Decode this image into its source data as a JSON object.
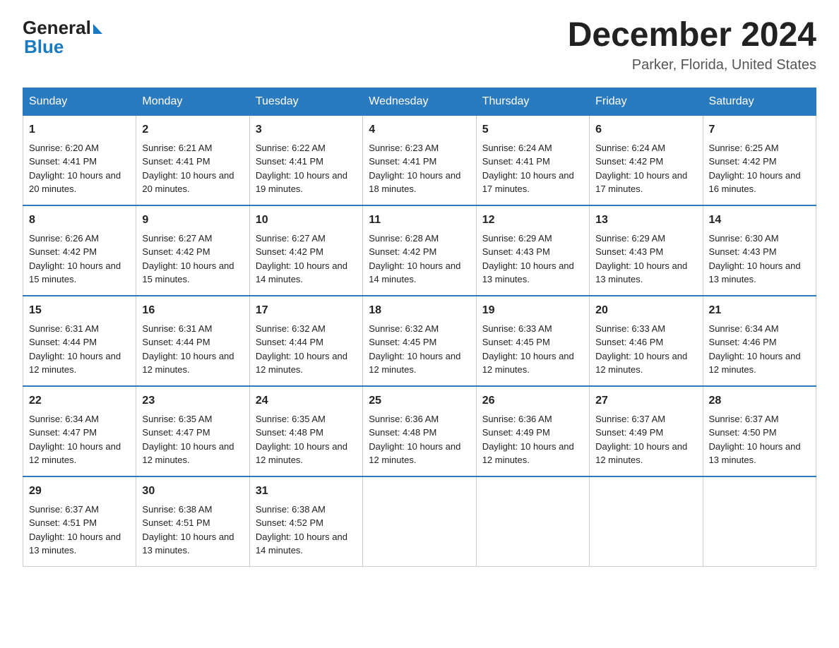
{
  "logo": {
    "line1": "General",
    "line2": "Blue"
  },
  "title": "December 2024",
  "subtitle": "Parker, Florida, United States",
  "days_header": [
    "Sunday",
    "Monday",
    "Tuesday",
    "Wednesday",
    "Thursday",
    "Friday",
    "Saturday"
  ],
  "weeks": [
    [
      {
        "num": "1",
        "sunrise": "6:20 AM",
        "sunset": "4:41 PM",
        "daylight": "10 hours and 20 minutes."
      },
      {
        "num": "2",
        "sunrise": "6:21 AM",
        "sunset": "4:41 PM",
        "daylight": "10 hours and 20 minutes."
      },
      {
        "num": "3",
        "sunrise": "6:22 AM",
        "sunset": "4:41 PM",
        "daylight": "10 hours and 19 minutes."
      },
      {
        "num": "4",
        "sunrise": "6:23 AM",
        "sunset": "4:41 PM",
        "daylight": "10 hours and 18 minutes."
      },
      {
        "num": "5",
        "sunrise": "6:24 AM",
        "sunset": "4:41 PM",
        "daylight": "10 hours and 17 minutes."
      },
      {
        "num": "6",
        "sunrise": "6:24 AM",
        "sunset": "4:42 PM",
        "daylight": "10 hours and 17 minutes."
      },
      {
        "num": "7",
        "sunrise": "6:25 AM",
        "sunset": "4:42 PM",
        "daylight": "10 hours and 16 minutes."
      }
    ],
    [
      {
        "num": "8",
        "sunrise": "6:26 AM",
        "sunset": "4:42 PM",
        "daylight": "10 hours and 15 minutes."
      },
      {
        "num": "9",
        "sunrise": "6:27 AM",
        "sunset": "4:42 PM",
        "daylight": "10 hours and 15 minutes."
      },
      {
        "num": "10",
        "sunrise": "6:27 AM",
        "sunset": "4:42 PM",
        "daylight": "10 hours and 14 minutes."
      },
      {
        "num": "11",
        "sunrise": "6:28 AM",
        "sunset": "4:42 PM",
        "daylight": "10 hours and 14 minutes."
      },
      {
        "num": "12",
        "sunrise": "6:29 AM",
        "sunset": "4:43 PM",
        "daylight": "10 hours and 13 minutes."
      },
      {
        "num": "13",
        "sunrise": "6:29 AM",
        "sunset": "4:43 PM",
        "daylight": "10 hours and 13 minutes."
      },
      {
        "num": "14",
        "sunrise": "6:30 AM",
        "sunset": "4:43 PM",
        "daylight": "10 hours and 13 minutes."
      }
    ],
    [
      {
        "num": "15",
        "sunrise": "6:31 AM",
        "sunset": "4:44 PM",
        "daylight": "10 hours and 12 minutes."
      },
      {
        "num": "16",
        "sunrise": "6:31 AM",
        "sunset": "4:44 PM",
        "daylight": "10 hours and 12 minutes."
      },
      {
        "num": "17",
        "sunrise": "6:32 AM",
        "sunset": "4:44 PM",
        "daylight": "10 hours and 12 minutes."
      },
      {
        "num": "18",
        "sunrise": "6:32 AM",
        "sunset": "4:45 PM",
        "daylight": "10 hours and 12 minutes."
      },
      {
        "num": "19",
        "sunrise": "6:33 AM",
        "sunset": "4:45 PM",
        "daylight": "10 hours and 12 minutes."
      },
      {
        "num": "20",
        "sunrise": "6:33 AM",
        "sunset": "4:46 PM",
        "daylight": "10 hours and 12 minutes."
      },
      {
        "num": "21",
        "sunrise": "6:34 AM",
        "sunset": "4:46 PM",
        "daylight": "10 hours and 12 minutes."
      }
    ],
    [
      {
        "num": "22",
        "sunrise": "6:34 AM",
        "sunset": "4:47 PM",
        "daylight": "10 hours and 12 minutes."
      },
      {
        "num": "23",
        "sunrise": "6:35 AM",
        "sunset": "4:47 PM",
        "daylight": "10 hours and 12 minutes."
      },
      {
        "num": "24",
        "sunrise": "6:35 AM",
        "sunset": "4:48 PM",
        "daylight": "10 hours and 12 minutes."
      },
      {
        "num": "25",
        "sunrise": "6:36 AM",
        "sunset": "4:48 PM",
        "daylight": "10 hours and 12 minutes."
      },
      {
        "num": "26",
        "sunrise": "6:36 AM",
        "sunset": "4:49 PM",
        "daylight": "10 hours and 12 minutes."
      },
      {
        "num": "27",
        "sunrise": "6:37 AM",
        "sunset": "4:49 PM",
        "daylight": "10 hours and 12 minutes."
      },
      {
        "num": "28",
        "sunrise": "6:37 AM",
        "sunset": "4:50 PM",
        "daylight": "10 hours and 13 minutes."
      }
    ],
    [
      {
        "num": "29",
        "sunrise": "6:37 AM",
        "sunset": "4:51 PM",
        "daylight": "10 hours and 13 minutes."
      },
      {
        "num": "30",
        "sunrise": "6:38 AM",
        "sunset": "4:51 PM",
        "daylight": "10 hours and 13 minutes."
      },
      {
        "num": "31",
        "sunrise": "6:38 AM",
        "sunset": "4:52 PM",
        "daylight": "10 hours and 14 minutes."
      },
      null,
      null,
      null,
      null
    ]
  ],
  "labels": {
    "sunrise": "Sunrise:",
    "sunset": "Sunset:",
    "daylight": "Daylight:"
  }
}
